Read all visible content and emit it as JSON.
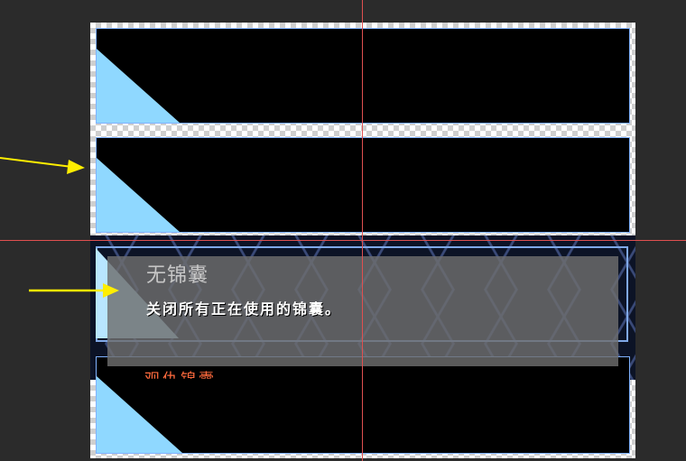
{
  "skill": {
    "name": "无锦囊",
    "description": "关闭所有正在使用的锦囊。",
    "partial_label": "观仇锦囊"
  },
  "colors": {
    "background": "#2b2b2b",
    "panel": "#000000",
    "panel_accent": "#8fd8ff",
    "panel_border": "#7fb2ff",
    "guide": "#e05050",
    "arrow": "#ffee00",
    "overlay": "#6e6e6e"
  },
  "icons": [
    "arrow-right-icon",
    "arrow-right-icon"
  ]
}
